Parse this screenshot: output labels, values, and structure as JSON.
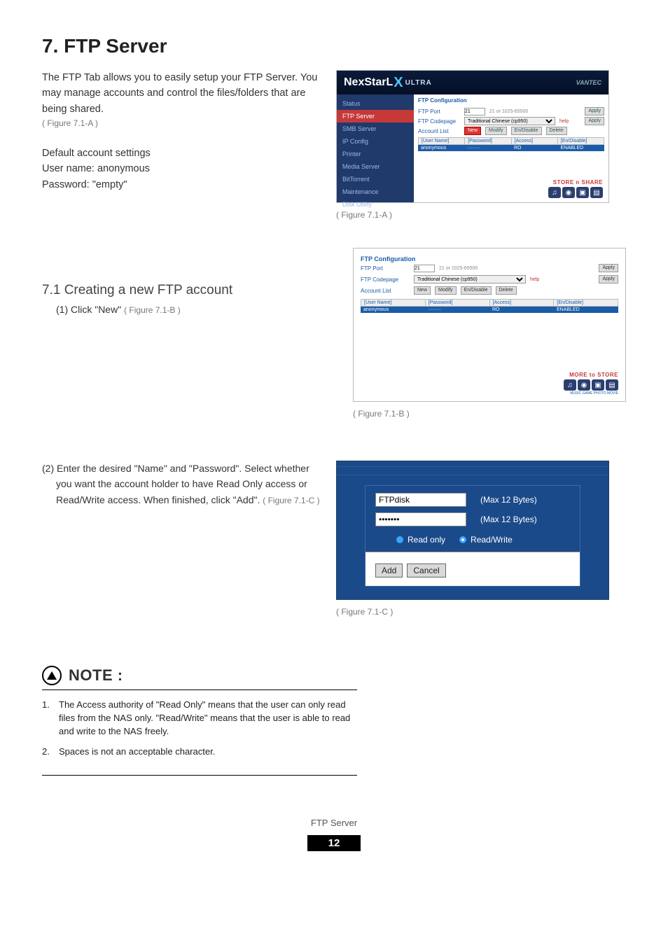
{
  "title": "7. FTP Server",
  "intro": "The FTP Tab allows you to easily setup your FTP Server. You may manage accounts and control the files/folders that are being shared.",
  "fig_a_ref": "( Figure 7.1-A )",
  "defaults": {
    "heading": "Default account settings",
    "user_line": "User name: anonymous",
    "pass_line": "Password: \"empty\""
  },
  "nexstar": {
    "brand_left": "NexStar",
    "brand_mid": "L",
    "brand_x": "X",
    "brand_ultra": "ULTRA",
    "vendor": "VANTEC"
  },
  "sidebar_items": [
    {
      "label": "Status",
      "active": false
    },
    {
      "label": "FTP Server",
      "active": true
    },
    {
      "label": "SMB Server",
      "active": false
    },
    {
      "label": "IP Config",
      "active": false
    },
    {
      "label": "Printer",
      "active": false
    },
    {
      "label": "Media Server",
      "active": false
    },
    {
      "label": "BitTorrent",
      "active": false
    },
    {
      "label": "Maintenance",
      "active": false
    },
    {
      "label": "Disk Utility",
      "active": false
    }
  ],
  "panel_a": {
    "cfg_title": "FTP Configuration",
    "port_label": "FTP Port",
    "port_value": "21",
    "port_hint": "21 or 1025-65500",
    "codepage_label": "FTP Codepage",
    "codepage_value": "Traditional Chinese (cp950)",
    "codepage_help": "help",
    "acct_label": "Account List",
    "btn_new": "New",
    "btn_modify": "Modify",
    "btn_endisable": "En/Disable",
    "btn_delete": "Delete",
    "apply": "Apply",
    "th_user": "[User Name]",
    "th_pass": "[Password]",
    "th_access": "[Access]",
    "th_endis": "[En/Disable]",
    "row_user": "anonymous",
    "row_pass": "········",
    "row_access": "RO",
    "row_endis": "ENABLED",
    "store_share": "STORE n SHARE",
    "more_to_store": "MORE to STORE",
    "caps": "MUSIC GAME PHOTO MOVIE"
  },
  "fig_a_cap": "( Figure 7.1-A )",
  "sec71_title": "7.1 Creating a new FTP account",
  "step1": "(1) Click \"New\" ",
  "step1_ref": "( Figure 7.1-B )",
  "fig_b_cap": "( Figure 7.1-B )",
  "step2": "(2) Enter the desired \"Name\" and \"Password\". Select whether you want the account holder to have Read Only access or Read/Write access. When finished, click \"Add\". ",
  "step2_ref": "( Figure 7.1-C )",
  "dialog_c": {
    "name_value": "FTPdisk",
    "max": "(Max 12 Bytes)",
    "pass_value": "•••••••",
    "ro": "Read only",
    "rw": "Read/Write",
    "add": "Add",
    "cancel": "Cancel"
  },
  "fig_c_cap": "( Figure 7.1-C )",
  "note_title": "NOTE :",
  "notes": [
    "The Access authority of \"Read Only\" means that the user can only read files from the NAS only. \"Read/Write\" means that the user is able to read and write to the NAS freely.",
    "Spaces is not an acceptable character."
  ],
  "footer_label": "FTP Server",
  "footer_page": "12"
}
